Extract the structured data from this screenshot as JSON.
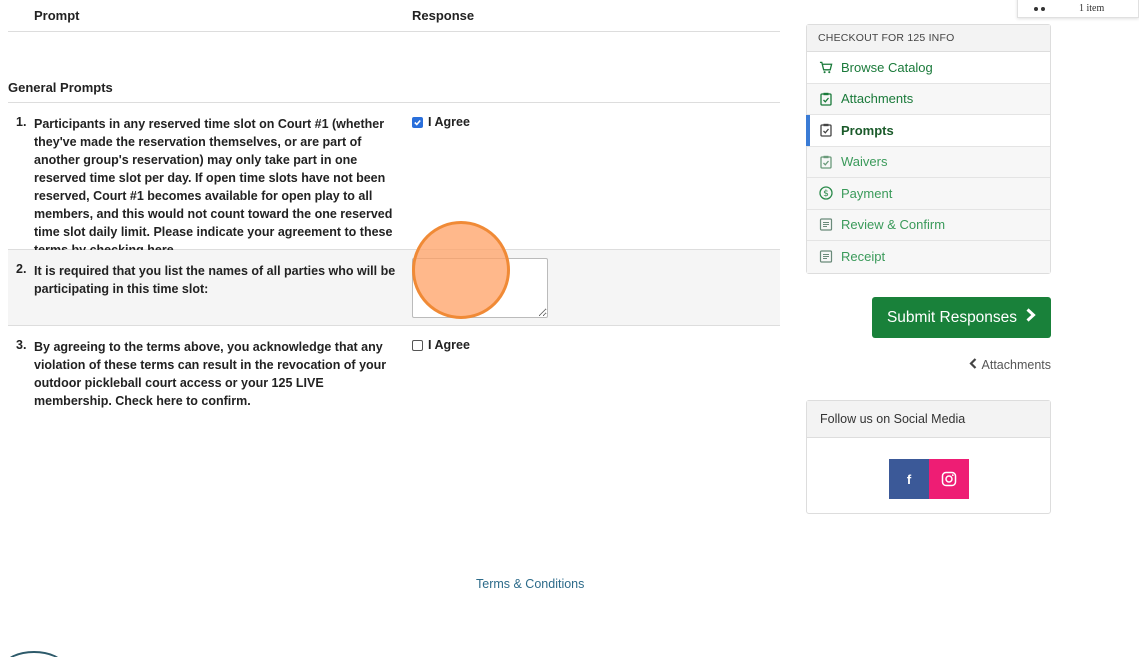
{
  "table": {
    "header_prompt": "Prompt",
    "header_response": "Response",
    "section_title": "General Prompts"
  },
  "prompts": [
    {
      "number": "1.",
      "text": "Participants in any reserved time slot on Court #1 (whether they've made the reservation themselves, or are part of another group's reservation) may only take part in one reserved time slot per day. If open time slots have not been reserved, Court #1 becomes available for open play to all members, and this would not count toward the one reserved time slot daily limit. Please indicate your agreement to these terms by checking here.",
      "response_label": "I Agree",
      "checked": true
    },
    {
      "number": "2.",
      "text": "It is required that you list the names of all parties who will be participating in this time slot:",
      "textarea_value": ""
    },
    {
      "number": "3.",
      "text": "By agreeing to the terms above, you acknowledge that any violation of these terms can result in the revocation of your outdoor pickleball court access or your 125 LIVE membership. Check here to confirm.",
      "response_label": "I Agree",
      "checked": false
    }
  ],
  "sidebar": {
    "title": "CHECKOUT FOR 125 INFO",
    "items": [
      {
        "label": "Browse Catalog",
        "icon": "cart-icon"
      },
      {
        "label": "Attachments",
        "icon": "clipboard-check-icon"
      },
      {
        "label": "Prompts",
        "icon": "clipboard-check-icon"
      },
      {
        "label": "Waivers",
        "icon": "clipboard-check-icon"
      },
      {
        "label": "Payment",
        "icon": "dollar-circle-icon"
      },
      {
        "label": "Review & Confirm",
        "icon": "receipt-icon"
      },
      {
        "label": "Receipt",
        "icon": "receipt-icon"
      }
    ]
  },
  "actions": {
    "submit_label": "Submit Responses",
    "back_label": "Attachments"
  },
  "social": {
    "title": "Follow us on Social Media",
    "facebook_glyph": "f"
  },
  "footer": {
    "terms_label": "Terms & Conditions"
  },
  "cart": {
    "count_label": "1 item"
  },
  "colors": {
    "primary_green": "#19813a",
    "active_accent": "#3a7bd5",
    "facebook": "#3b5998",
    "instagram": "#ee1d74",
    "click_marker": "#f08a36"
  }
}
